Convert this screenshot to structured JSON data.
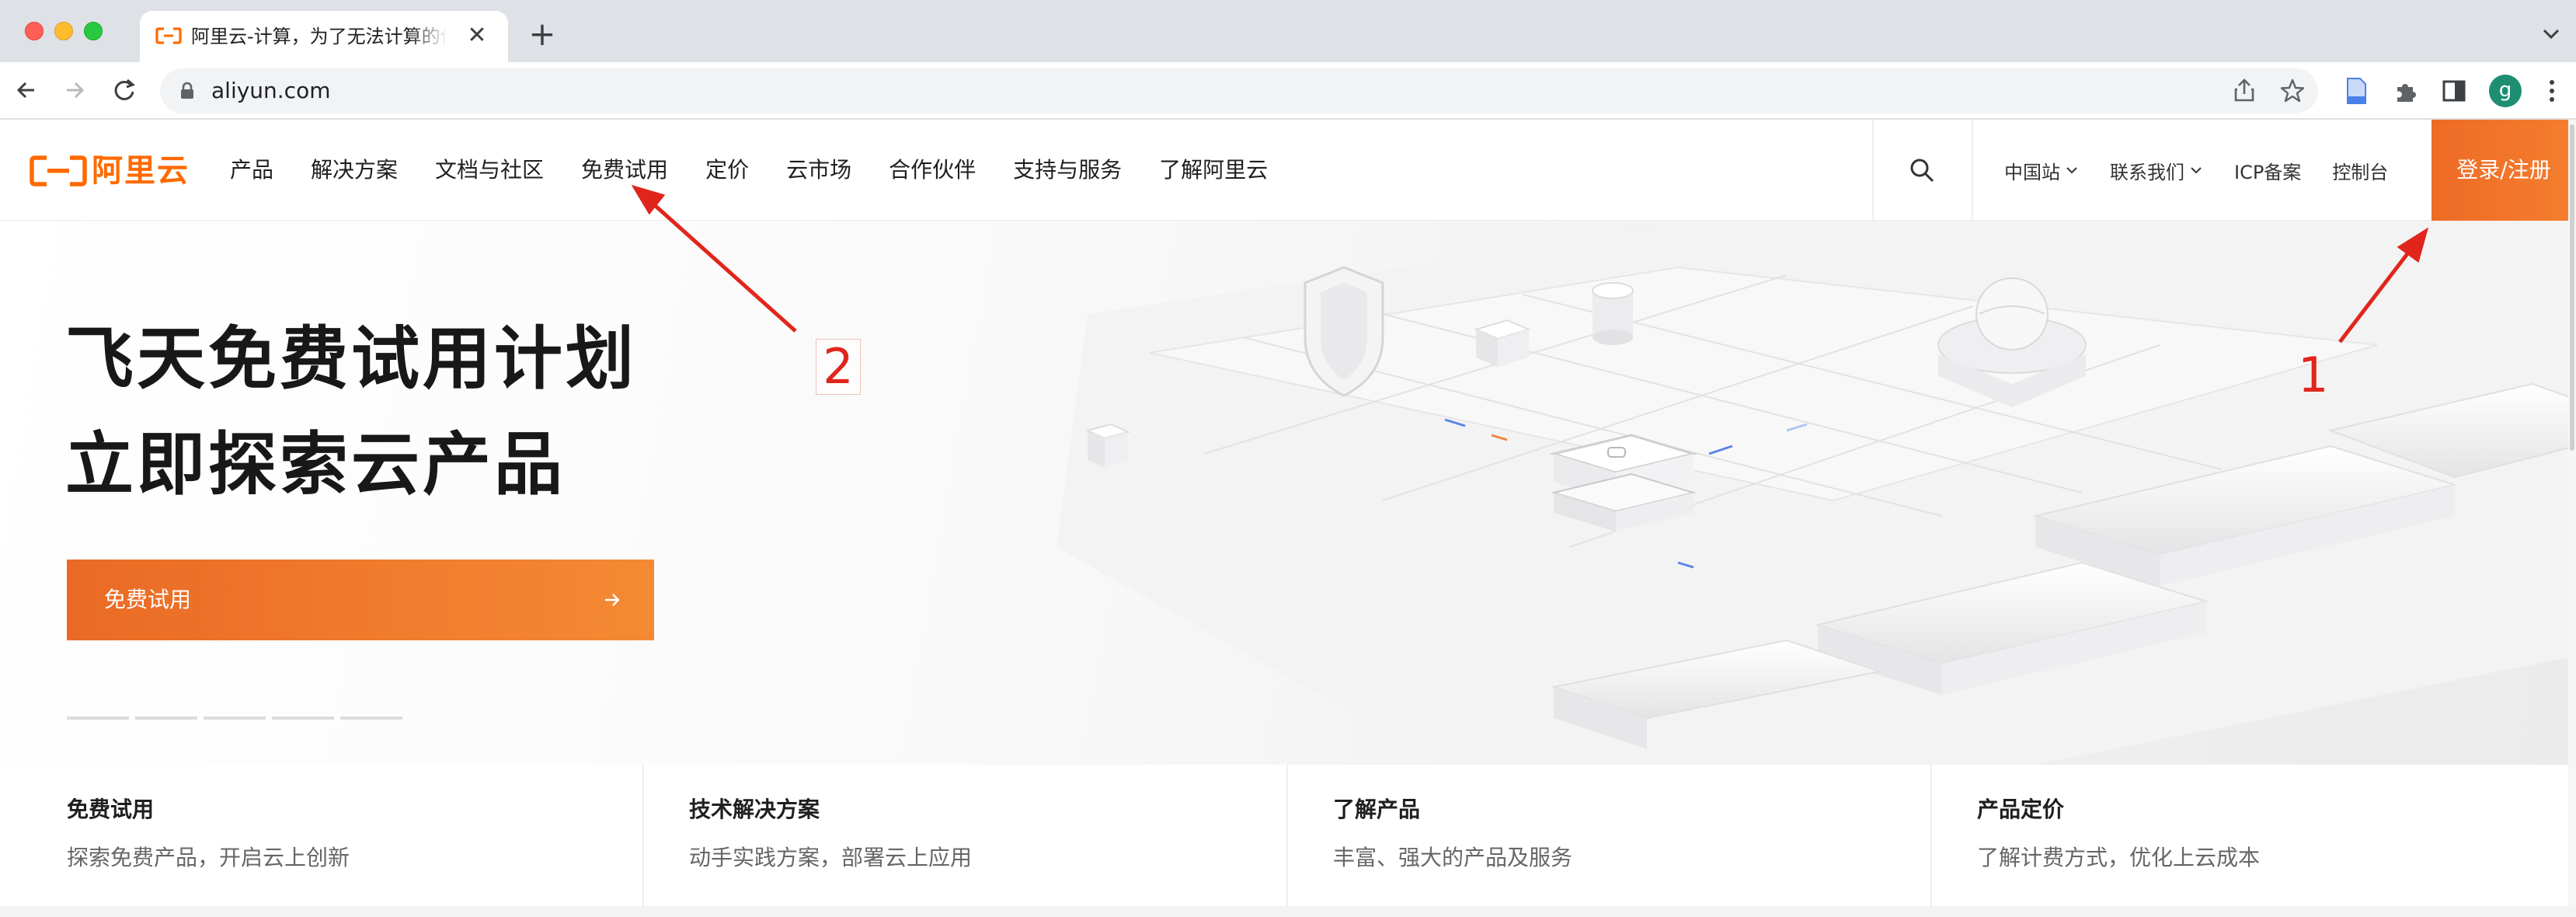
{
  "browser": {
    "tab_title": "阿里云-计算，为了无法计算的价值",
    "tab_close": "✕",
    "new_tab": "+",
    "url": "aliyun.com",
    "profile_initial": "g"
  },
  "header": {
    "logo_text": "阿里云",
    "nav": [
      "产品",
      "解决方案",
      "文档与社区",
      "免费试用",
      "定价",
      "云市场",
      "合作伙伴",
      "支持与服务",
      "了解阿里云"
    ],
    "utility": {
      "region": "中国站",
      "contact": "联系我们",
      "icp": "ICP备案",
      "console": "控制台"
    },
    "login_label": "登录/注册"
  },
  "hero": {
    "title_line1": "飞天免费试用计划",
    "title_line2": "立即探索云产品",
    "cta_label": "免费试用",
    "slides_count": 5
  },
  "features": [
    {
      "title": "免费试用",
      "desc": "探索免费产品，开启云上创新"
    },
    {
      "title": "技术解决方案",
      "desc": "动手实践方案，部署云上应用"
    },
    {
      "title": "了解产品",
      "desc": "丰富、强大的产品及服务"
    },
    {
      "title": "产品定价",
      "desc": "了解计费方式，优化上云成本"
    }
  ],
  "annotations": {
    "label_1": "1",
    "label_2": "2",
    "color": "#e0261c"
  },
  "colors": {
    "brand": "#ff6a00",
    "cta_gradient_start": "#ea6a25",
    "cta_gradient_end": "#f48a34"
  }
}
